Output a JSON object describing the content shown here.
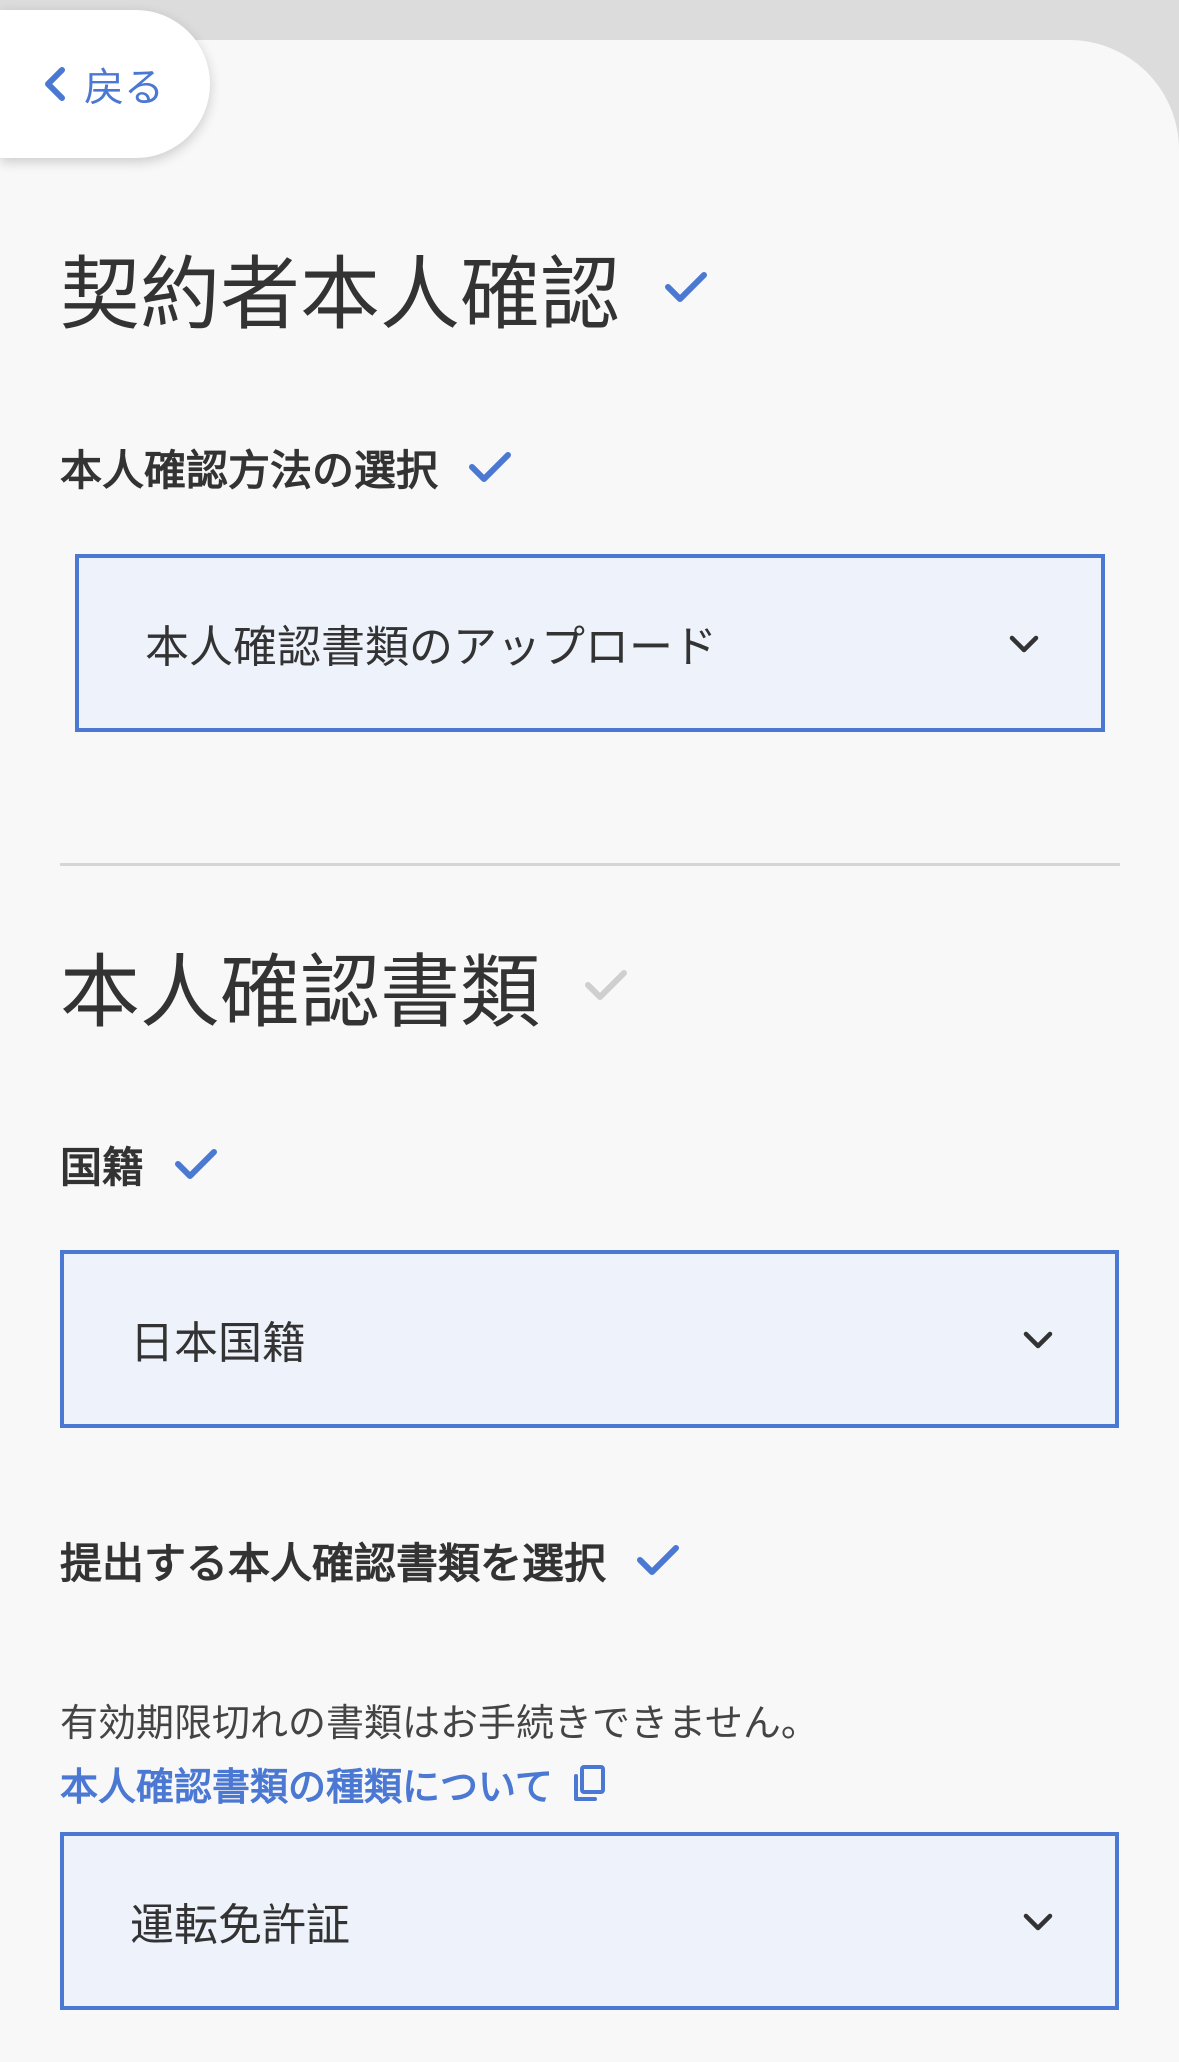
{
  "nav": {
    "back_label": "戻る"
  },
  "section1": {
    "title": "契約者本人確認",
    "method_label": "本人確認方法の選択",
    "method_value": "本人確認書類のアップロード"
  },
  "section2": {
    "title": "本人確認書類",
    "nationality_label": "国籍",
    "nationality_value": "日本国籍",
    "document_label": "提出する本人確認書類を選択",
    "note": "有効期限切れの書類はお手続きできません。",
    "info_link": "本人確認書類の種類について",
    "document_value": "運転免許証"
  },
  "colors": {
    "accent": "#4a78d3",
    "check_active": "#4a78d3",
    "check_inactive": "#cfcfcf",
    "field_bg": "#eef2fb"
  },
  "icons": {
    "back": "chevron-left-icon",
    "check": "check-icon",
    "dropdown": "chevron-down-icon",
    "external": "external-window-icon"
  }
}
